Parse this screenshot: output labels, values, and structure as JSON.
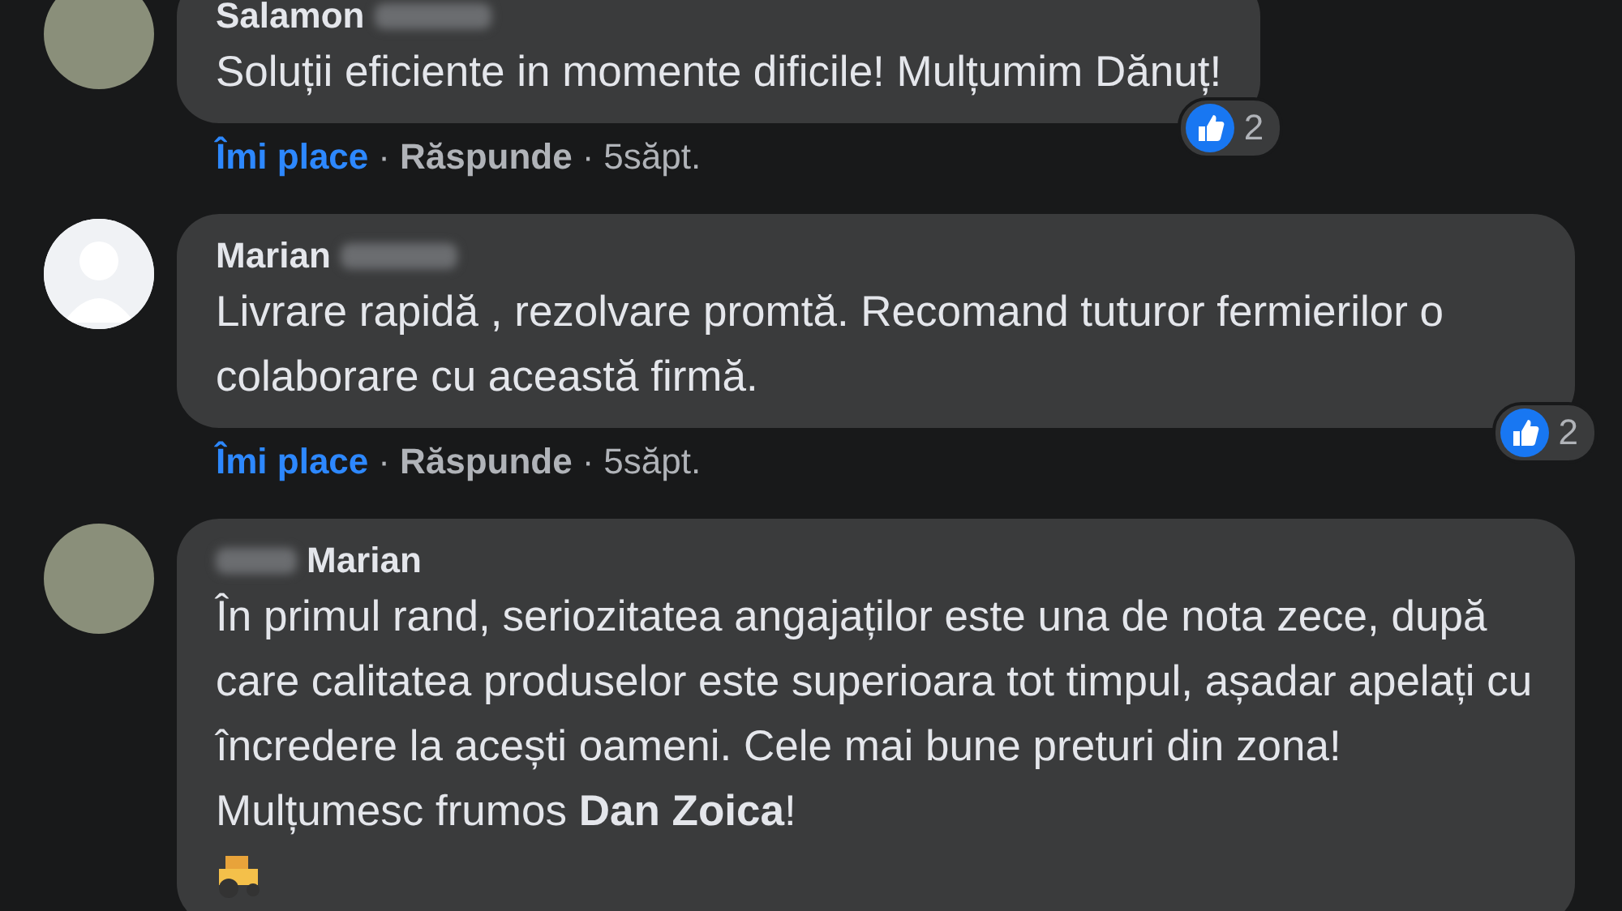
{
  "comments": [
    {
      "author": "Salamon",
      "author_blurred": true,
      "blur_first": false,
      "avatar": {
        "kind": "photo"
      },
      "text": "Soluții eficiente in momente dificile! Mulțumim Dănuț!",
      "reactions": "2",
      "actions": {
        "like": "Îmi place",
        "separator_1": "·",
        "reply": "Răspunde",
        "separator_2": "·",
        "time": "5săpt."
      }
    },
    {
      "author": "Marian",
      "author_blurred": true,
      "blur_first": false,
      "avatar": {
        "kind": "default"
      },
      "text": "Livrare rapidă , rezolvare promtă. Recomand tuturor fermierilor o colaborare cu această firmă.",
      "reactions": "2",
      "actions": {
        "like": "Îmi place",
        "separator_1": "·",
        "reply": "Răspunde",
        "separator_2": "·",
        "time": "5săpt."
      }
    },
    {
      "author": "Marian",
      "author_blurred": true,
      "blur_first": true,
      "avatar": {
        "kind": "photo"
      },
      "text": "În primul rand, seriozitatea angajaților este una de nota zece, după care calitatea produselor este superioara tot timpul, așadar apelați cu încredere la acești oameni. Cele mai bune preturi din zona! Mulțumesc frumos **Dan Zoica**!",
      "trailing_emoji": true
    }
  ]
}
